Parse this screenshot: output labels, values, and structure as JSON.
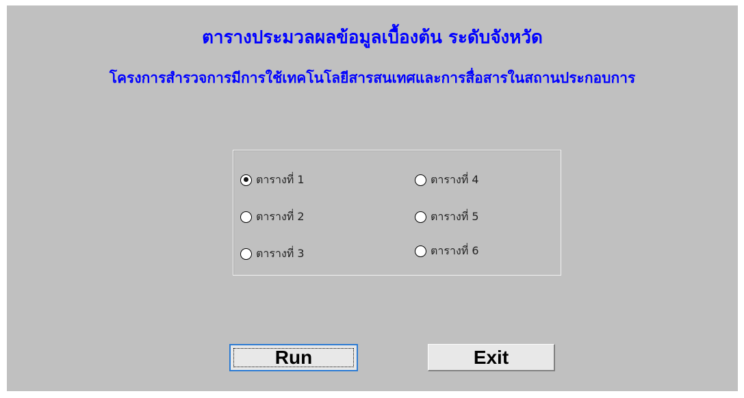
{
  "header": {
    "title": "ตารางประมวลผลข้อมูลเบื้องต้น ระดับจังหวัด",
    "subtitle": "โครงการสำรวจการมีการใช้เทคโนโลยีสารสนเทศและการสื่อสารในสถานประกอบการ"
  },
  "options": [
    {
      "label": "ตารางที่ 1",
      "selected": true
    },
    {
      "label": "ตารางที่ 2",
      "selected": false
    },
    {
      "label": "ตารางที่ 3",
      "selected": false
    },
    {
      "label": "ตารางที่ 4",
      "selected": false
    },
    {
      "label": "ตารางที่ 5",
      "selected": false
    },
    {
      "label": "ตารางที่ 6",
      "selected": false
    }
  ],
  "buttons": {
    "run_label": "Run",
    "exit_label": "Exit"
  },
  "colors": {
    "background": "#c0c0c0",
    "title": "#0000ff"
  }
}
